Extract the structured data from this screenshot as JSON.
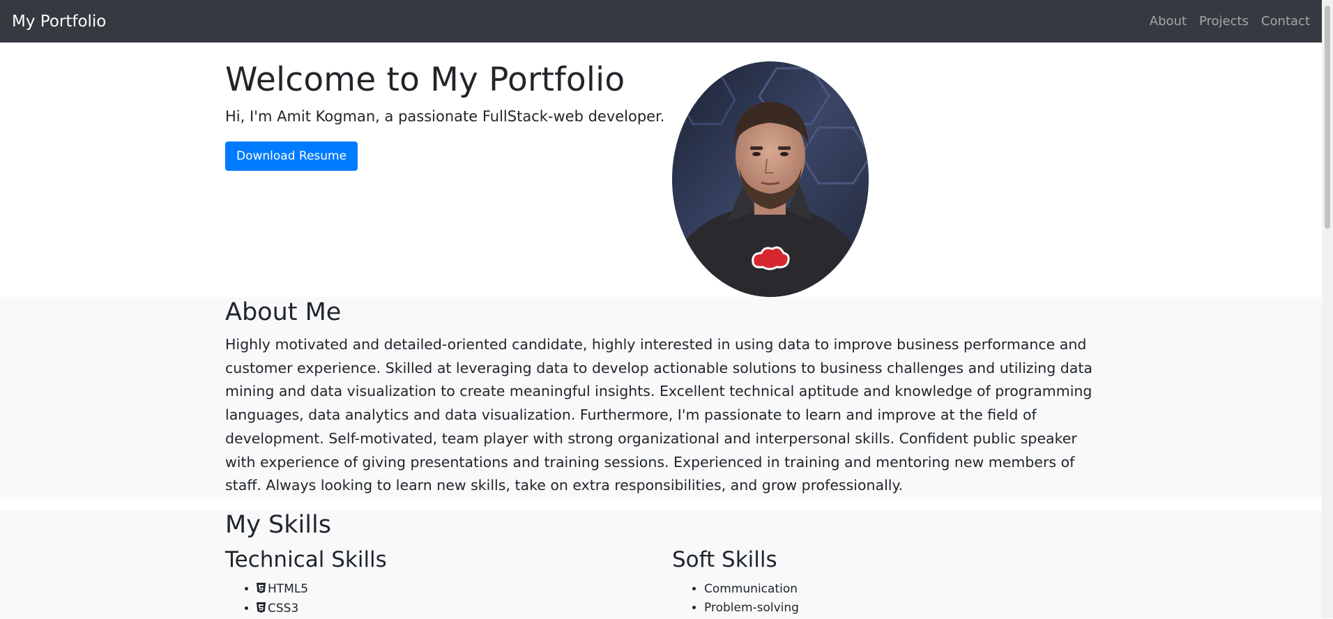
{
  "navbar": {
    "brand": "My Portfolio",
    "links": [
      "About",
      "Projects",
      "Contact"
    ]
  },
  "hero": {
    "title": "Welcome to My Portfolio",
    "subtitle": "Hi, I'm Amit Kogman, a passionate FullStack-web developer.",
    "button_label": "Download Resume",
    "avatar_alt": "Profile photo"
  },
  "about": {
    "title": "About Me",
    "text": "Highly motivated and detailed-oriented candidate, highly interested in using data to improve business performance and customer experience. Skilled at leveraging data to develop actionable solutions to business challenges and utilizing data mining and data visualization to create meaningful insights. Excellent technical aptitude and knowledge of programming languages, data analytics and data visualization. Furthermore, I'm passionate to learn and improve at the field of development. Self-motivated, team player with strong organizational and interpersonal skills. Confident public speaker with experience of giving presentations and training sessions. Experienced in training and mentoring new members of staff. Always looking to learn new skills, take on extra responsibilities, and grow professionally."
  },
  "skills": {
    "title": "My Skills",
    "technical": {
      "title": "Technical Skills",
      "items": [
        {
          "label": "HTML5",
          "icon": "html5-icon"
        },
        {
          "label": "CSS3",
          "icon": "css3-icon"
        }
      ]
    },
    "soft": {
      "title": "Soft Skills",
      "items": [
        "Communication",
        "Problem-solving"
      ]
    }
  },
  "colors": {
    "navbar_bg": "#343a40",
    "primary": "#007bff",
    "section_bg": "#f8f9fa"
  }
}
